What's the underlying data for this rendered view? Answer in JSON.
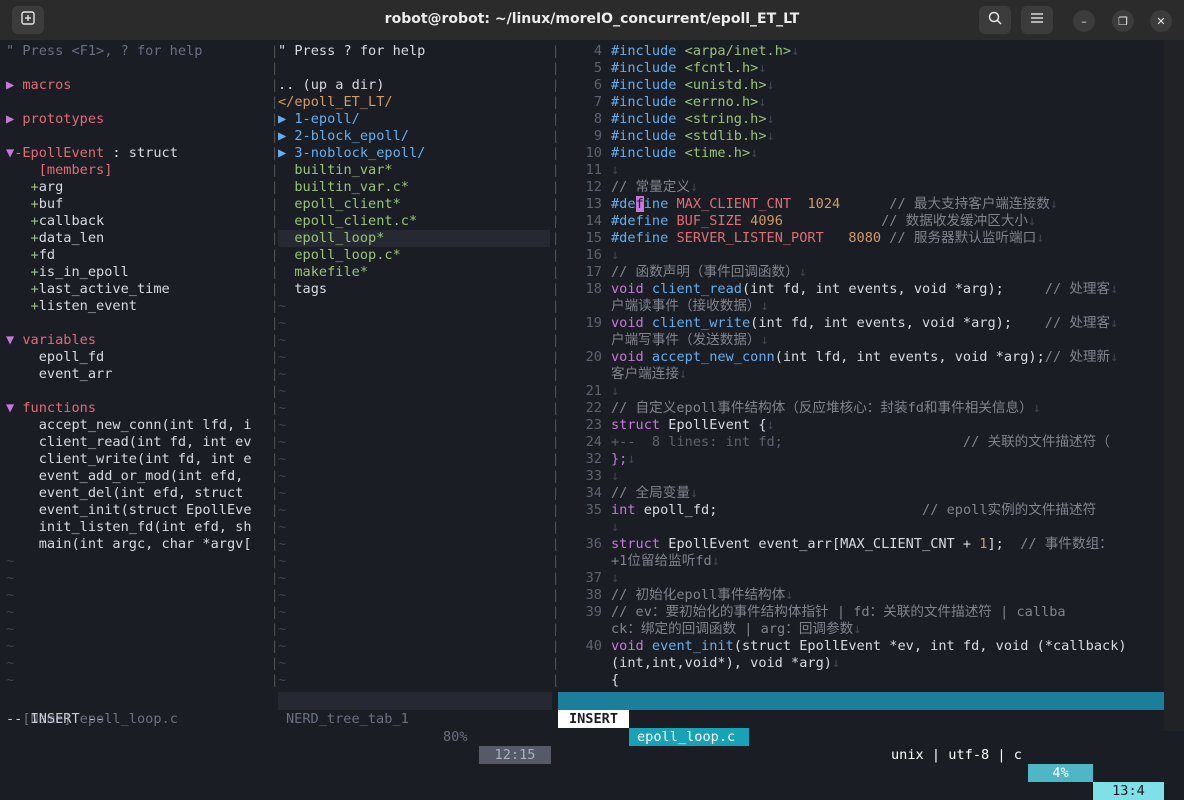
{
  "window": {
    "title": "robot@robot: ~/linux/moreIO_concurrent/epoll_ET_LT",
    "new_tab_icon": "new-tab-icon",
    "search_icon": "search-icon",
    "menu_icon": "hamburger-menu-icon",
    "minimize": "–",
    "maximize": "❐",
    "close": "✕"
  },
  "tagbar": {
    "help": "\" Press <F1>, ? for help",
    "lines": [
      {
        "row": 2,
        "parts": [
          {
            "t": "▶ ",
            "c": "c-mag"
          },
          {
            "t": "macros",
            "c": "c-red"
          }
        ]
      },
      {
        "row": 4,
        "parts": [
          {
            "t": "▶ ",
            "c": "c-mag"
          },
          {
            "t": "prototypes",
            "c": "c-red"
          }
        ]
      },
      {
        "row": 6,
        "parts": [
          {
            "t": "▼",
            "c": "c-mag"
          },
          {
            "t": "-EpollEvent",
            "c": "c-red"
          },
          {
            "t": " : struct",
            "c": "c-white"
          }
        ]
      },
      {
        "row": 7,
        "parts": [
          {
            "t": "    [members]",
            "c": "c-red"
          }
        ]
      },
      {
        "row": 8,
        "parts": [
          {
            "t": "   +",
            "c": "c-green"
          },
          {
            "t": "arg",
            "c": "c-white"
          }
        ]
      },
      {
        "row": 9,
        "parts": [
          {
            "t": "   +",
            "c": "c-green"
          },
          {
            "t": "buf",
            "c": "c-white"
          }
        ]
      },
      {
        "row": 10,
        "parts": [
          {
            "t": "   +",
            "c": "c-green"
          },
          {
            "t": "callback",
            "c": "c-white"
          }
        ]
      },
      {
        "row": 11,
        "parts": [
          {
            "t": "   +",
            "c": "c-green"
          },
          {
            "t": "data_len",
            "c": "c-white"
          }
        ]
      },
      {
        "row": 12,
        "parts": [
          {
            "t": "   +",
            "c": "c-green"
          },
          {
            "t": "fd",
            "c": "c-white"
          }
        ]
      },
      {
        "row": 13,
        "parts": [
          {
            "t": "   +",
            "c": "c-green"
          },
          {
            "t": "is_in_epoll",
            "c": "c-white"
          }
        ]
      },
      {
        "row": 14,
        "parts": [
          {
            "t": "   +",
            "c": "c-green"
          },
          {
            "t": "last_active_time",
            "c": "c-white"
          }
        ]
      },
      {
        "row": 15,
        "parts": [
          {
            "t": "   +",
            "c": "c-green"
          },
          {
            "t": "listen_event",
            "c": "c-white"
          }
        ]
      },
      {
        "row": 17,
        "parts": [
          {
            "t": "▼ ",
            "c": "c-mag"
          },
          {
            "t": "variables",
            "c": "c-red"
          }
        ]
      },
      {
        "row": 18,
        "parts": [
          {
            "t": "    epoll_fd",
            "c": "c-white"
          }
        ]
      },
      {
        "row": 19,
        "parts": [
          {
            "t": "    event_arr",
            "c": "c-white"
          }
        ]
      },
      {
        "row": 21,
        "parts": [
          {
            "t": "▼ ",
            "c": "c-mag"
          },
          {
            "t": "functions",
            "c": "c-red"
          }
        ]
      },
      {
        "row": 22,
        "parts": [
          {
            "t": "    accept_new_conn",
            "c": "c-white"
          },
          {
            "t": "(int lfd, i",
            "c": "c-white"
          }
        ]
      },
      {
        "row": 23,
        "parts": [
          {
            "t": "    client_read",
            "c": "c-white"
          },
          {
            "t": "(int fd, int ev",
            "c": "c-white"
          }
        ]
      },
      {
        "row": 24,
        "parts": [
          {
            "t": "    client_write",
            "c": "c-white"
          },
          {
            "t": "(int fd, int e",
            "c": "c-white"
          }
        ]
      },
      {
        "row": 25,
        "parts": [
          {
            "t": "    event_add_or_mod",
            "c": "c-white"
          },
          {
            "t": "(int efd, ",
            "c": "c-white"
          }
        ]
      },
      {
        "row": 26,
        "parts": [
          {
            "t": "    event_del",
            "c": "c-white"
          },
          {
            "t": "(int efd, struct",
            "c": "c-white"
          }
        ]
      },
      {
        "row": 27,
        "parts": [
          {
            "t": "    event_init",
            "c": "c-white"
          },
          {
            "t": "(struct EpollEve",
            "c": "c-white"
          }
        ]
      },
      {
        "row": 28,
        "parts": [
          {
            "t": "    init_listen_fd",
            "c": "c-white"
          },
          {
            "t": "(int efd, sh",
            "c": "c-white"
          }
        ]
      },
      {
        "row": 29,
        "parts": [
          {
            "t": "    main",
            "c": "c-white"
          },
          {
            "t": "(int argc, char *argv[",
            "c": "c-white"
          }
        ]
      }
    ],
    "status": "[Name] epoll_loop.c"
  },
  "nerdtree": {
    "help": "\" Press ? for help",
    "lines": [
      {
        "row": 2,
        "parts": [
          {
            "t": ".. (up a dir)",
            "c": "c-white"
          }
        ]
      },
      {
        "row": 3,
        "parts": [
          {
            "t": "</epoll_ET_LT/",
            "c": "c-orange"
          }
        ]
      },
      {
        "row": 4,
        "parts": [
          {
            "t": "▶ ",
            "c": "c-blue"
          },
          {
            "t": "1-epoll/",
            "c": "c-blue"
          }
        ]
      },
      {
        "row": 5,
        "parts": [
          {
            "t": "▶ ",
            "c": "c-blue"
          },
          {
            "t": "2-block_epoll/",
            "c": "c-blue"
          }
        ]
      },
      {
        "row": 6,
        "parts": [
          {
            "t": "▶ ",
            "c": "c-blue"
          },
          {
            "t": "3-noblock_epoll/",
            "c": "c-blue"
          }
        ]
      },
      {
        "row": 7,
        "parts": [
          {
            "t": "  builtin_var*",
            "c": "c-green"
          }
        ]
      },
      {
        "row": 8,
        "parts": [
          {
            "t": "  builtin_var.c*",
            "c": "c-green"
          }
        ]
      },
      {
        "row": 9,
        "parts": [
          {
            "t": "  epoll_client*",
            "c": "c-green"
          }
        ]
      },
      {
        "row": 10,
        "parts": [
          {
            "t": "  epoll_client.c*",
            "c": "c-green"
          }
        ]
      },
      {
        "row": 11,
        "parts": [
          {
            "t": "  epoll_loop*",
            "c": "c-green"
          }
        ],
        "hl": true
      },
      {
        "row": 12,
        "parts": [
          {
            "t": "  epoll_loop.c*",
            "c": "c-green"
          }
        ]
      },
      {
        "row": 13,
        "parts": [
          {
            "t": "  makefile*",
            "c": "c-green"
          }
        ]
      },
      {
        "row": 14,
        "parts": [
          {
            "t": "  tags",
            "c": "c-white"
          }
        ]
      }
    ],
    "status_name": "NERD_tree_tab_1",
    "status_pct": "80%",
    "status_pos": "12:15"
  },
  "editor": {
    "lines": [
      {
        "row": 0,
        "n": "4",
        "parts": [
          {
            "t": "#include ",
            "c": "c-inc"
          },
          {
            "t": "<arpa/inet.h>",
            "c": "c-green"
          },
          {
            "t": "↓",
            "c": "c-eol"
          }
        ]
      },
      {
        "row": 1,
        "n": "5",
        "parts": [
          {
            "t": "#include ",
            "c": "c-inc"
          },
          {
            "t": "<fcntl.h>",
            "c": "c-green"
          },
          {
            "t": "↓",
            "c": "c-eol"
          }
        ]
      },
      {
        "row": 2,
        "n": "6",
        "parts": [
          {
            "t": "#include ",
            "c": "c-inc"
          },
          {
            "t": "<unistd.h>",
            "c": "c-green"
          },
          {
            "t": "↓",
            "c": "c-eol"
          }
        ]
      },
      {
        "row": 3,
        "n": "7",
        "parts": [
          {
            "t": "#include ",
            "c": "c-inc"
          },
          {
            "t": "<errno.h>",
            "c": "c-green"
          },
          {
            "t": "↓",
            "c": "c-eol"
          }
        ]
      },
      {
        "row": 4,
        "n": "8",
        "parts": [
          {
            "t": "#include ",
            "c": "c-inc"
          },
          {
            "t": "<string.h>",
            "c": "c-green"
          },
          {
            "t": "↓",
            "c": "c-eol"
          }
        ]
      },
      {
        "row": 5,
        "n": "9",
        "parts": [
          {
            "t": "#include ",
            "c": "c-inc"
          },
          {
            "t": "<stdlib.h>",
            "c": "c-green"
          },
          {
            "t": "↓",
            "c": "c-eol"
          }
        ]
      },
      {
        "row": 6,
        "n": "10",
        "parts": [
          {
            "t": "#include ",
            "c": "c-inc"
          },
          {
            "t": "<time.h>",
            "c": "c-green"
          },
          {
            "t": "↓",
            "c": "c-eol"
          }
        ]
      },
      {
        "row": 7,
        "n": "11",
        "parts": [
          {
            "t": "↓",
            "c": "c-eol"
          }
        ]
      },
      {
        "row": 8,
        "n": "12",
        "parts": [
          {
            "t": "// 常量定义",
            "c": "c-cmt"
          },
          {
            "t": "↓",
            "c": "c-eol"
          }
        ]
      },
      {
        "row": 9,
        "n": "13",
        "parts": [
          {
            "t": "#de",
            "c": "c-inc"
          },
          {
            "t": "f",
            "c": "cursor"
          },
          {
            "t": "ine ",
            "c": "c-inc"
          },
          {
            "t": "MAX_CLIENT_CNT  ",
            "c": "c-red"
          },
          {
            "t": "1024",
            "c": "c-orange"
          },
          {
            "t": "      // 最大支持客户端连接数",
            "c": "c-cmt"
          },
          {
            "t": "↓",
            "c": "c-eol"
          }
        ]
      },
      {
        "row": 10,
        "n": "14",
        "parts": [
          {
            "t": "#define ",
            "c": "c-inc"
          },
          {
            "t": "BUF_SIZE ",
            "c": "c-red"
          },
          {
            "t": "4096",
            "c": "c-orange"
          },
          {
            "t": "            // 数据收发缓冲区大小",
            "c": "c-cmt"
          },
          {
            "t": "↓",
            "c": "c-eol"
          }
        ]
      },
      {
        "row": 11,
        "n": "15",
        "parts": [
          {
            "t": "#define ",
            "c": "c-inc"
          },
          {
            "t": "SERVER_LISTEN_PORT   ",
            "c": "c-red"
          },
          {
            "t": "8080",
            "c": "c-orange"
          },
          {
            "t": " // 服务器默认监听端口",
            "c": "c-cmt"
          },
          {
            "t": "↓",
            "c": "c-eol"
          }
        ]
      },
      {
        "row": 12,
        "n": "16",
        "parts": [
          {
            "t": "↓",
            "c": "c-eol"
          }
        ]
      },
      {
        "row": 13,
        "n": "17",
        "parts": [
          {
            "t": "// 函数声明（事件回调函数）",
            "c": "c-cmt"
          },
          {
            "t": "↓",
            "c": "c-eol"
          }
        ]
      },
      {
        "row": 14,
        "n": "18",
        "parts": [
          {
            "t": "void ",
            "c": "c-mag"
          },
          {
            "t": "client_read",
            "c": "c-fn"
          },
          {
            "t": "(int fd, int events, void *arg);     ",
            "c": "c-white"
          },
          {
            "t": "// 处理客",
            "c": "c-cmt"
          },
          {
            "t": "↓",
            "c": "c-eol"
          }
        ]
      },
      {
        "row": 15,
        "n": "",
        "parts": [
          {
            "t": "户端读事件（接收数据）",
            "c": "c-cmt"
          },
          {
            "t": "↓",
            "c": "c-eol"
          }
        ]
      },
      {
        "row": 16,
        "n": "19",
        "parts": [
          {
            "t": "void ",
            "c": "c-mag"
          },
          {
            "t": "client_write",
            "c": "c-fn"
          },
          {
            "t": "(int fd, int events, void *arg);    ",
            "c": "c-white"
          },
          {
            "t": "// 处理客",
            "c": "c-cmt"
          },
          {
            "t": "↓",
            "c": "c-eol"
          }
        ]
      },
      {
        "row": 17,
        "n": "",
        "parts": [
          {
            "t": "户端写事件（发送数据）",
            "c": "c-cmt"
          },
          {
            "t": "↓",
            "c": "c-eol"
          }
        ]
      },
      {
        "row": 18,
        "n": "20",
        "parts": [
          {
            "t": "void ",
            "c": "c-mag"
          },
          {
            "t": "accept_new_conn",
            "c": "c-fn"
          },
          {
            "t": "(int lfd, int events, void *arg);",
            "c": "c-white"
          },
          {
            "t": "// 处理新",
            "c": "c-cmt"
          },
          {
            "t": "↓",
            "c": "c-eol"
          }
        ]
      },
      {
        "row": 19,
        "n": "",
        "parts": [
          {
            "t": "客户端连接",
            "c": "c-cmt"
          },
          {
            "t": "↓",
            "c": "c-eol"
          }
        ]
      },
      {
        "row": 20,
        "n": "21",
        "parts": [
          {
            "t": "↓",
            "c": "c-eol"
          }
        ]
      },
      {
        "row": 21,
        "n": "22",
        "parts": [
          {
            "t": "// 自定义epoll事件结构体（反应堆核心：封装fd和事件相关信息）",
            "c": "c-cmt"
          },
          {
            "t": "↓",
            "c": "c-eol"
          }
        ]
      },
      {
        "row": 22,
        "n": "23",
        "parts": [
          {
            "t": "struct ",
            "c": "c-mag"
          },
          {
            "t": "EpollEvent {",
            "c": "c-white"
          },
          {
            "t": "↓",
            "c": "c-eol"
          }
        ]
      },
      {
        "row": 23,
        "n": "24",
        "parts": [
          {
            "t": "+--  8 lines: int fd;",
            "c": "c-num"
          },
          {
            "t": "                      // 关联的文件描述符（",
            "c": "c-cmt"
          }
        ]
      },
      {
        "row": 24,
        "n": "32",
        "parts": [
          {
            "t": "};",
            "c": "c-mag"
          },
          {
            "t": "↓",
            "c": "c-eol"
          }
        ]
      },
      {
        "row": 25,
        "n": "33",
        "parts": [
          {
            "t": "↓",
            "c": "c-eol"
          }
        ]
      },
      {
        "row": 26,
        "n": "34",
        "parts": [
          {
            "t": "// 全局变量",
            "c": "c-cmt"
          },
          {
            "t": "↓",
            "c": "c-eol"
          }
        ]
      },
      {
        "row": 27,
        "n": "35",
        "parts": [
          {
            "t": "int ",
            "c": "c-mag"
          },
          {
            "t": "epoll_fd;",
            "c": "c-white"
          },
          {
            "t": "                         // epoll实例的文件描述符",
            "c": "c-cmt"
          }
        ]
      },
      {
        "row": 28,
        "n": "",
        "parts": [
          {
            "t": "↓",
            "c": "c-eol"
          }
        ]
      },
      {
        "row": 29,
        "n": "36",
        "parts": [
          {
            "t": "struct ",
            "c": "c-mag"
          },
          {
            "t": "EpollEvent event_arr[MAX_CLIENT_CNT + ",
            "c": "c-white"
          },
          {
            "t": "1",
            "c": "c-orange"
          },
          {
            "t": "];  ",
            "c": "c-white"
          },
          {
            "t": "// 事件数组：",
            "c": "c-cmt"
          }
        ]
      },
      {
        "row": 30,
        "n": "",
        "parts": [
          {
            "t": "+1位留给监听fd",
            "c": "c-cmt"
          },
          {
            "t": "↓",
            "c": "c-eol"
          }
        ]
      },
      {
        "row": 31,
        "n": "37",
        "parts": [
          {
            "t": "↓",
            "c": "c-eol"
          }
        ]
      },
      {
        "row": 32,
        "n": "38",
        "parts": [
          {
            "t": "// 初始化epoll事件结构体",
            "c": "c-cmt"
          },
          {
            "t": "↓",
            "c": "c-eol"
          }
        ]
      },
      {
        "row": 33,
        "n": "39",
        "parts": [
          {
            "t": "// ev：要初始化的事件结构体指针 | fd：关联的文件描述符 | callba",
            "c": "c-cmt"
          }
        ]
      },
      {
        "row": 34,
        "n": "",
        "parts": [
          {
            "t": "ck：绑定的回调函数 | arg：回调参数",
            "c": "c-cmt"
          },
          {
            "t": "↓",
            "c": "c-eol"
          }
        ]
      },
      {
        "row": 35,
        "n": "40",
        "parts": [
          {
            "t": "void ",
            "c": "c-mag"
          },
          {
            "t": "event_init",
            "c": "c-fn"
          },
          {
            "t": "(struct EpollEvent *ev, int fd, void (*callback)",
            "c": "c-white"
          }
        ]
      },
      {
        "row": 36,
        "n": "",
        "parts": [
          {
            "t": "(int,int,void*), void *arg)",
            "c": "c-white"
          },
          {
            "t": "↓",
            "c": "c-eol"
          }
        ]
      },
      {
        "row": 37,
        "n": "",
        "parts": [
          {
            "t": "{",
            "c": "c-white"
          }
        ]
      }
    ],
    "mode": "INSERT",
    "filename": "epoll_loop.c",
    "fileformat": "unix | utf-8 | c",
    "percent": "4%",
    "position": "13:4"
  },
  "cmdline": "-- INSERT --",
  "colors": {
    "mode_bg": "#ffffff",
    "file_bg": "#1b7f9c",
    "status_bg": "#1b7f9c",
    "pos_bg": "#7fe0e8"
  }
}
